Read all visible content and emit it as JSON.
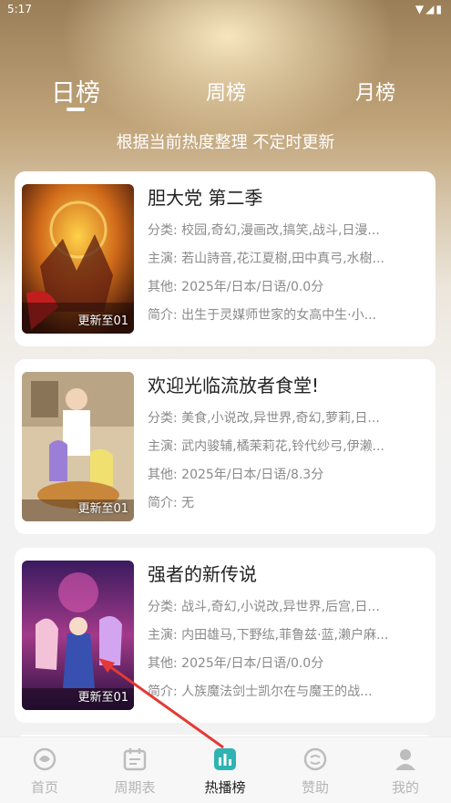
{
  "status_bar": {
    "time": "5:17"
  },
  "tabs": [
    {
      "label": "日榜",
      "active": true
    },
    {
      "label": "周榜",
      "active": false
    },
    {
      "label": "月榜",
      "active": false
    }
  ],
  "subtitle": "根据当前热度整理 不定时更新",
  "items": [
    {
      "title": "胆大党 第二季",
      "category": "分类: 校园,奇幻,漫画改,搞笑,战斗,日漫...",
      "cast": "主演: 若山詩音,花江夏樹,田中真弓,水樹...",
      "other": "其他: 2025年/日本/日语/0.0分",
      "intro": "简介: 出生于灵媒师世家的女高中生·小...",
      "update": "更新至01"
    },
    {
      "title": "欢迎光临流放者食堂!",
      "category": "分类: 美食,小说改,异世界,奇幻,萝莉,日...",
      "cast": "主演: 武内骏辅,橘茉莉花,铃代纱弓,伊濑...",
      "other": "其他: 2025年/日本/日语/8.3分",
      "intro": "简介: 无",
      "update": "更新至01"
    },
    {
      "title": "强者的新传说",
      "category": "分类: 战斗,奇幻,小说改,异世界,后宫,日...",
      "cast": "主演: 内田雄马,下野纮,菲鲁兹·蓝,濑户麻...",
      "other": "其他: 2025年/日本/日语/0.0分",
      "intro": "简介: 人族魔法剑士凯尔在与魔王的战...",
      "update": "更新至01"
    }
  ],
  "nav": [
    {
      "label": "首页",
      "icon": "home-icon",
      "active": false
    },
    {
      "label": "周期表",
      "icon": "calendar-icon",
      "active": false
    },
    {
      "label": "热播榜",
      "icon": "chart-icon",
      "active": true
    },
    {
      "label": "赞助",
      "icon": "sponsor-icon",
      "active": false
    },
    {
      "label": "我的",
      "icon": "profile-icon",
      "active": false
    }
  ],
  "colors": {
    "accent": "#2fb3b3",
    "nav_inactive": "#b5b5b5",
    "arrow": "#e53935"
  }
}
